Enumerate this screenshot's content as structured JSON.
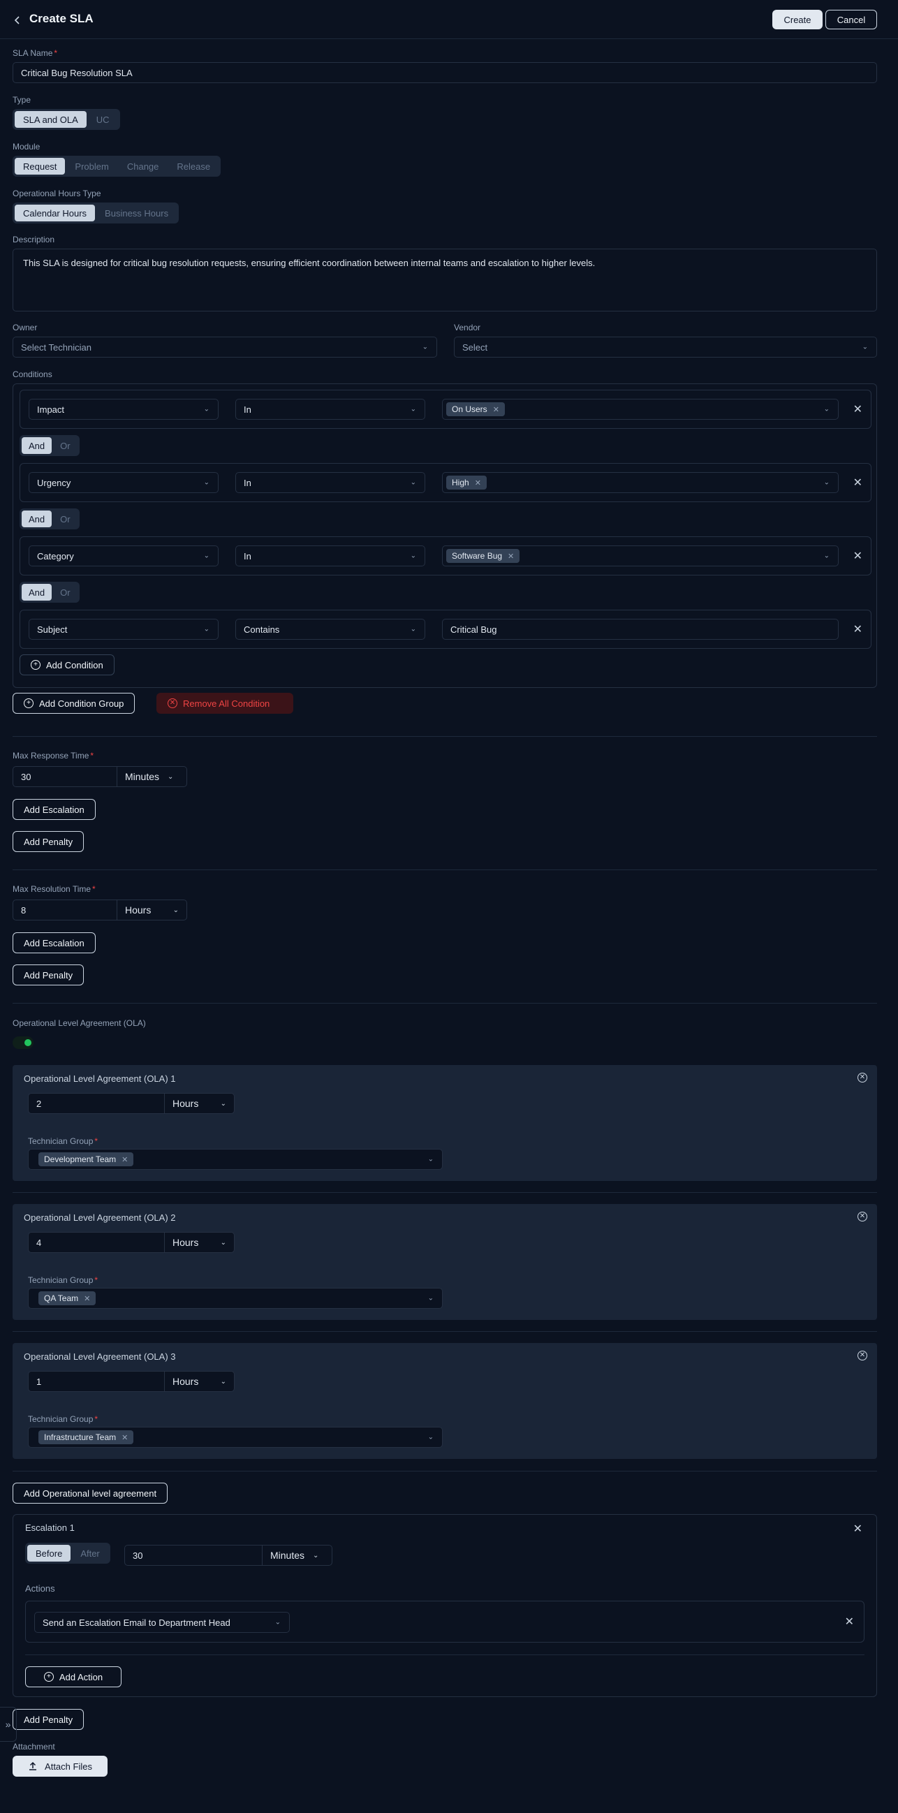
{
  "header": {
    "title": "Create SLA",
    "create_label": "Create",
    "cancel_label": "Cancel"
  },
  "sla_name": {
    "label": "SLA Name",
    "value": "Critical Bug Resolution SLA"
  },
  "type": {
    "label": "Type",
    "options": [
      "SLA and OLA",
      "UC"
    ],
    "selected": "SLA and OLA"
  },
  "module": {
    "label": "Module",
    "options": [
      "Request",
      "Problem",
      "Change",
      "Release"
    ],
    "selected": "Request"
  },
  "op_hours": {
    "label": "Operational Hours Type",
    "options": [
      "Calendar Hours",
      "Business Hours"
    ],
    "selected": "Calendar Hours"
  },
  "description": {
    "label": "Description",
    "value": "This SLA is designed for critical bug resolution requests, ensuring efficient coordination between internal teams and escalation to higher levels."
  },
  "owner": {
    "label": "Owner",
    "placeholder": "Select Technician"
  },
  "vendor": {
    "label": "Vendor",
    "placeholder": "Select"
  },
  "conditions": {
    "label": "Conditions",
    "rows": [
      {
        "field": "Impact",
        "operator": "In",
        "value": "On Users"
      },
      {
        "field": "Urgency",
        "operator": "In",
        "value": "High"
      },
      {
        "field": "Category",
        "operator": "In",
        "value": "Software Bug"
      },
      {
        "field": "Subject",
        "operator": "Contains",
        "value": "Critical Bug"
      }
    ],
    "joiner_options": [
      "And",
      "Or"
    ],
    "add_condition_label": "Add Condition",
    "add_group_label": "Add Condition Group",
    "remove_all_label": "Remove All Condition"
  },
  "max_response": {
    "label": "Max Response Time",
    "value": "30",
    "unit": "Minutes",
    "add_escalation": "Add Escalation",
    "add_penalty": "Add Penalty"
  },
  "max_resolution": {
    "label": "Max Resolution Time",
    "value": "8",
    "unit": "Hours",
    "add_escalation": "Add Escalation",
    "add_penalty": "Add Penalty"
  },
  "ola": {
    "label": "Operational Level Agreement (OLA)",
    "enabled": true,
    "group_label": "Technician Group",
    "items": [
      {
        "title": "Operational Level Agreement (OLA) 1",
        "value": "2",
        "unit": "Hours",
        "group": "Development Team"
      },
      {
        "title": "Operational Level Agreement (OLA) 2",
        "value": "4",
        "unit": "Hours",
        "group": "QA Team"
      },
      {
        "title": "Operational Level Agreement (OLA) 3",
        "value": "1",
        "unit": "Hours",
        "group": "Infrastructure Team"
      }
    ],
    "add_label": "Add Operational level agreement"
  },
  "escalation": {
    "title": "Escalation 1",
    "timing_options": [
      "Before",
      "After"
    ],
    "timing_selected": "Before",
    "value": "30",
    "unit": "Minutes",
    "actions_label": "Actions",
    "action": "Send an Escalation Email to Department Head",
    "add_action_label": "Add Action"
  },
  "add_penalty_bottom": "Add Penalty",
  "attachment": {
    "label": "Attachment",
    "button": "Attach Files"
  }
}
